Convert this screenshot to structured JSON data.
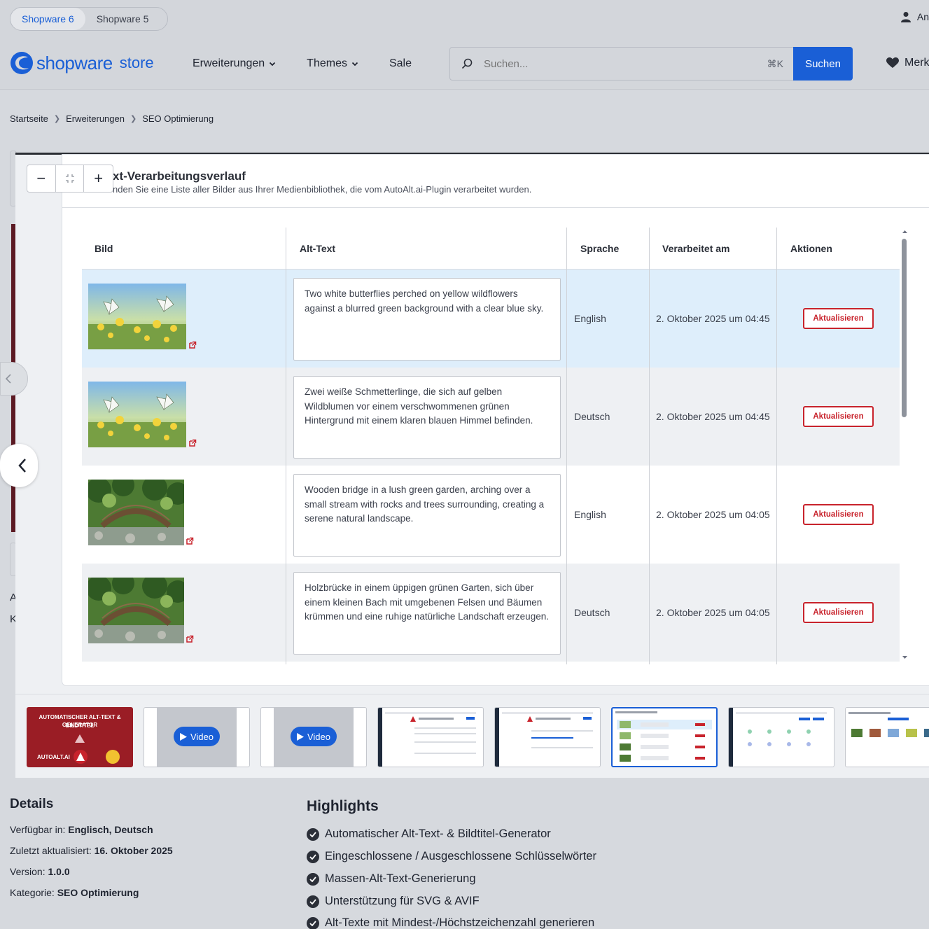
{
  "topbar": {
    "tabs": [
      {
        "label": "Shopware 6"
      },
      {
        "label": "Shopware 5"
      }
    ],
    "account_label": "An"
  },
  "header": {
    "logo_text": "shopware",
    "logo_store": "store",
    "nav": [
      {
        "label": "Erweiterungen"
      },
      {
        "label": "Themes"
      },
      {
        "label": "Sale"
      }
    ],
    "search_placeholder": "Suchen...",
    "search_shortcut": "⌘K",
    "search_button": "Suchen",
    "wishlist_label": "Merk"
  },
  "breadcrumb": [
    "Startseite",
    "Erweiterungen",
    "SEO Optimierung"
  ],
  "background_letters": [
    "A",
    "K"
  ],
  "lightbox": {
    "zoom_out": "−",
    "zoom_in": "+",
    "screenshot": {
      "title": "xt-Verarbeitungsverlauf",
      "subtitle": "nden Sie eine Liste aller Bilder aus Ihrer Medienbibliothek, die vom AutoAlt.ai-Plugin verarbeitet wurden.",
      "columns": [
        "Bild",
        "Alt-Text",
        "Sprache",
        "Verarbeitet am",
        "Aktionen"
      ],
      "rows": [
        {
          "image": "butterflies",
          "alt_text": "Two white butterflies perched on yellow wildflowers against a blurred green background with a clear blue sky.",
          "language": "English",
          "processed": "2. Oktober 2025 um 04:45",
          "action": "Aktualisieren"
        },
        {
          "image": "butterflies",
          "alt_text": "Zwei weiße Schmetterlinge, die sich auf gelben Wildblumen vor einem verschwommenen grünen Hintergrund mit einem klaren blauen Himmel befinden.",
          "language": "Deutsch",
          "processed": "2. Oktober 2025 um 04:45",
          "action": "Aktualisieren"
        },
        {
          "image": "bridge",
          "alt_text": "Wooden bridge in a lush green garden, arching over a small stream with rocks and trees surrounding, creating a serene natural landscape.",
          "language": "English",
          "processed": "2. Oktober 2025 um 04:05",
          "action": "Aktualisieren"
        },
        {
          "image": "bridge",
          "alt_text": "Holzbrücke in einem üppigen grünen Garten, sich über einem kleinen Bach mit umgebenen Felsen und Bäumen krümmen und eine ruhige natürliche Landschaft erzeugen.",
          "language": "Deutsch",
          "processed": "2. Oktober 2025 um 04:05",
          "action": "Aktualisieren"
        }
      ]
    },
    "thumbnails": [
      {
        "kind": "banner",
        "line1": "AUTOMATISCHER ALT-TEXT & BILDTITEL",
        "line2": "GENERATOR",
        "brand": "AUTOALT.AI"
      },
      {
        "kind": "video",
        "label": "Video"
      },
      {
        "kind": "video",
        "label": "Video"
      },
      {
        "kind": "screen"
      },
      {
        "kind": "screen"
      },
      {
        "kind": "screen",
        "active": true
      },
      {
        "kind": "screen"
      },
      {
        "kind": "screen"
      }
    ]
  },
  "details": {
    "title": "Details",
    "items": [
      {
        "label": "Verfügbar in:",
        "value": "Englisch, Deutsch"
      },
      {
        "label": "Zuletzt aktualisiert:",
        "value": "16. Oktober 2025"
      },
      {
        "label": "Version:",
        "value": "1.0.0"
      },
      {
        "label": "Kategorie:",
        "value": "SEO Optimierung"
      }
    ]
  },
  "highlights": {
    "title": "Highlights",
    "items": [
      "Automatischer Alt-Text- & Bildtitel-Generator",
      "Eingeschlossene / Ausgeschlossene Schlüsselwörter",
      "Massen-Alt-Text-Generierung",
      "Unterstützung für SVG & AVIF",
      "Alt-Texte mit Mindest-/Höchstzeichenzahl generieren"
    ]
  },
  "colors": {
    "accent": "#1a5fd6",
    "danger": "#c8232c",
    "selected_row": "#deeefb"
  }
}
